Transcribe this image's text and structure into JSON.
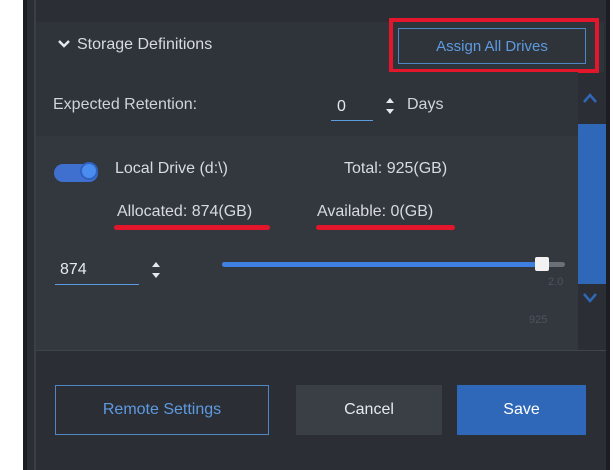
{
  "header": {
    "title": "Storage Definitions",
    "assign_all_label": "Assign All Drives"
  },
  "retention": {
    "label": "Expected Retention:",
    "value": "0",
    "unit": "Days"
  },
  "drive": {
    "name": "Local Drive (d:\\)",
    "enabled": true,
    "total": "Total: 925(GB)",
    "allocated": "Allocated: 874(GB)",
    "available": "Available: 0(GB)",
    "size_value": "874",
    "slider_fraction": 0.945,
    "faint_marks": [
      "2.0",
      "925"
    ]
  },
  "footer": {
    "remote_label": "Remote Settings",
    "cancel_label": "Cancel",
    "save_label": "Save"
  },
  "icons": {
    "header": "chevron-down-icon",
    "steppers": "up-down-stepper-icon",
    "scroll": [
      "chevron-up-icon",
      "chevron-down-icon"
    ]
  },
  "colors": {
    "accent": "#3f7fe0",
    "highlight": "#e3162b",
    "panel": "#2b2f35"
  }
}
